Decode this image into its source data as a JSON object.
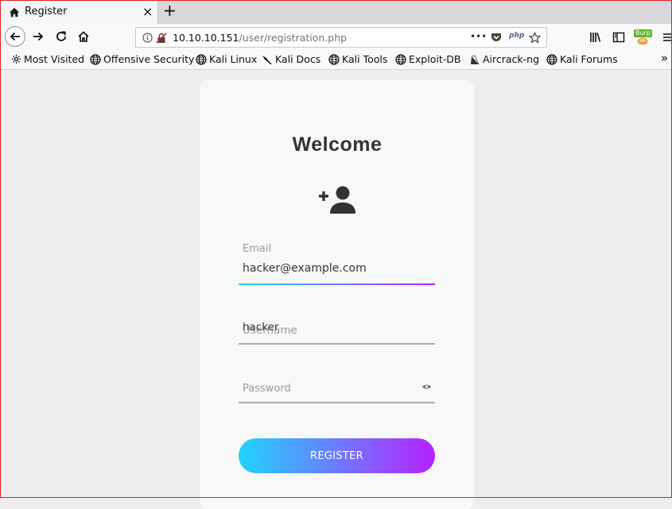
{
  "browser": {
    "tab": {
      "title": "Register",
      "close": "×"
    },
    "new_tab": "+",
    "url": {
      "host": "10.10.10.151",
      "path": "/user/registration.php"
    },
    "page_actions": {
      "more": "•••",
      "php_badge": "php"
    },
    "burp_label": "Burp",
    "bookmarks": [
      {
        "label": "Most Visited",
        "icon": "gear-icon"
      },
      {
        "label": "Offensive Security",
        "icon": "globe-icon"
      },
      {
        "label": "Kali Linux",
        "icon": "globe-icon"
      },
      {
        "label": "Kali Docs",
        "icon": "kali-dragon-icon"
      },
      {
        "label": "Kali Tools",
        "icon": "globe-icon"
      },
      {
        "label": "Exploit-DB",
        "icon": "globe-icon"
      },
      {
        "label": "Aircrack-ng",
        "icon": "aircrack-icon"
      },
      {
        "label": "Kali Forums",
        "icon": "globe-icon"
      }
    ],
    "overflow": "»"
  },
  "form": {
    "title": "Welcome",
    "email": {
      "label": "Email",
      "value": "hacker@example.com"
    },
    "username": {
      "placeholder": "Username",
      "value": "hacker"
    },
    "password": {
      "placeholder": "Password"
    },
    "submit_label": "REGISTER"
  },
  "colors": {
    "gradient_start": "#21d4fd",
    "gradient_end": "#b721ff"
  }
}
